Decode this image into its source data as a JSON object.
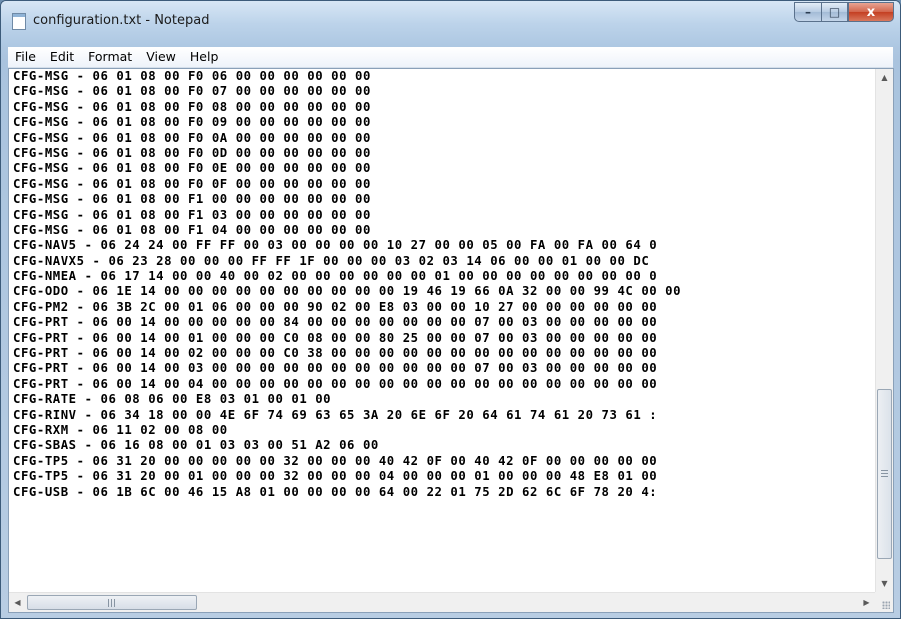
{
  "window": {
    "title": "configuration.txt - Notepad",
    "buttons": {
      "minimize": "–",
      "maximize": "□",
      "close": "x"
    }
  },
  "menu": [
    "File",
    "Edit",
    "Format",
    "View",
    "Help"
  ],
  "scrollbar_arrows": {
    "up": "▲",
    "down": "▼",
    "left": "◀",
    "right": "▶"
  },
  "document": {
    "lines": [
      "CFG-MSG - 06 01 08 00 F0 06 00 00 00 00 00 00",
      "CFG-MSG - 06 01 08 00 F0 07 00 00 00 00 00 00",
      "CFG-MSG - 06 01 08 00 F0 08 00 00 00 00 00 00",
      "CFG-MSG - 06 01 08 00 F0 09 00 00 00 00 00 00",
      "CFG-MSG - 06 01 08 00 F0 0A 00 00 00 00 00 00",
      "CFG-MSG - 06 01 08 00 F0 0D 00 00 00 00 00 00",
      "CFG-MSG - 06 01 08 00 F0 0E 00 00 00 00 00 00",
      "CFG-MSG - 06 01 08 00 F0 0F 00 00 00 00 00 00",
      "CFG-MSG - 06 01 08 00 F1 00 00 00 00 00 00 00",
      "CFG-MSG - 06 01 08 00 F1 03 00 00 00 00 00 00",
      "CFG-MSG - 06 01 08 00 F1 04 00 00 00 00 00 00",
      "CFG-NAV5 - 06 24 24 00 FF FF 00 03 00 00 00 00 10 27 00 00 05 00 FA 00 FA 00 64 0",
      "CFG-NAVX5 - 06 23 28 00 00 00 FF FF 1F 00 00 00 03 02 03 14 06 00 00 01 00 00 DC",
      "CFG-NMEA - 06 17 14 00 00 40 00 02 00 00 00 00 00 00 01 00 00 00 00 00 00 00 00 0",
      "CFG-ODO - 06 1E 14 00 00 00 00 00 00 00 00 00 00 19 46 19 66 0A 32 00 00 99 4C 00 00",
      "CFG-PM2 - 06 3B 2C 00 01 06 00 00 00 90 02 00 E8 03 00 00 10 27 00 00 00 00 00 00",
      "CFG-PRT - 06 00 14 00 00 00 00 00 84 00 00 00 00 00 00 00 07 00 03 00 00 00 00 00",
      "CFG-PRT - 06 00 14 00 01 00 00 00 C0 08 00 00 80 25 00 00 07 00 03 00 00 00 00 00",
      "CFG-PRT - 06 00 14 00 02 00 00 00 C0 38 00 00 00 00 00 00 00 00 00 00 00 00 00 00",
      "CFG-PRT - 06 00 14 00 03 00 00 00 00 00 00 00 00 00 00 00 07 00 03 00 00 00 00 00",
      "CFG-PRT - 06 00 14 00 04 00 00 00 00 00 00 00 00 00 00 00 00 00 00 00 00 00 00 00",
      "CFG-RATE - 06 08 06 00 E8 03 01 00 01 00",
      "CFG-RINV - 06 34 18 00 00 4E 6F 74 69 63 65 3A 20 6E 6F 20 64 61 74 61 20 73 61 :",
      "CFG-RXM - 06 11 02 00 08 00",
      "CFG-SBAS - 06 16 08 00 01 03 03 00 51 A2 06 00",
      "CFG-TP5 - 06 31 20 00 00 00 00 00 32 00 00 00 40 42 0F 00 40 42 0F 00 00 00 00 00",
      "CFG-TP5 - 06 31 20 00 01 00 00 00 32 00 00 00 04 00 00 00 01 00 00 00 48 E8 01 00",
      "CFG-USB - 06 1B 6C 00 46 15 A8 01 00 00 00 00 64 00 22 01 75 2D 62 6C 6F 78 20 4:",
      ""
    ]
  }
}
